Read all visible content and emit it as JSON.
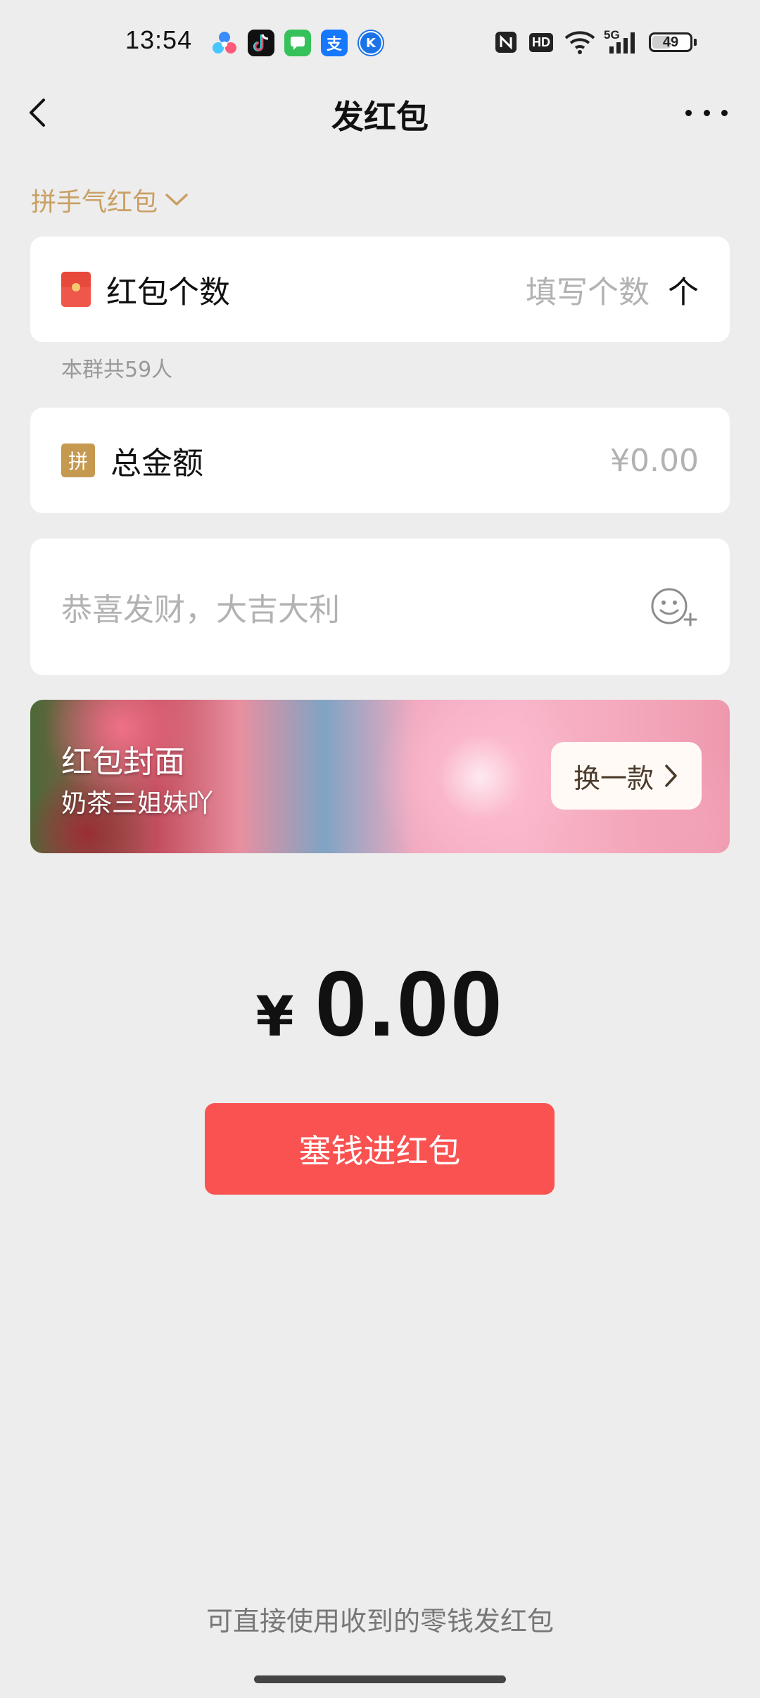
{
  "status_bar": {
    "time": "13:54",
    "apps": [
      "baidu-map-icon",
      "tiktok-icon",
      "messages-icon",
      "alipay-icon",
      "k-app-icon"
    ],
    "alipay_glyph": "支",
    "k_glyph": "K",
    "network": "5G",
    "hd": "HD",
    "battery": "49"
  },
  "nav": {
    "title": "发红包"
  },
  "type_selector": {
    "label": "拼手气红包"
  },
  "count_card": {
    "label": "红包个数",
    "placeholder": "填写个数",
    "unit": "个",
    "note": "本群共59人"
  },
  "amount_card": {
    "badge": "拼",
    "label": "总金额",
    "placeholder": "¥0.00"
  },
  "greeting_card": {
    "placeholder": "恭喜发财，大吉大利"
  },
  "cover": {
    "title": "红包封面",
    "subtitle": "奶茶三姐妹吖",
    "swap_label": "换一款"
  },
  "total": {
    "symbol": "¥",
    "value": "0.00"
  },
  "submit": {
    "label": "塞钱进红包"
  },
  "footer": {
    "note": "可直接使用收到的零钱发红包"
  },
  "colors": {
    "accent_red": "#fa5151",
    "gold": "#c9a064",
    "background": "#ededed"
  }
}
